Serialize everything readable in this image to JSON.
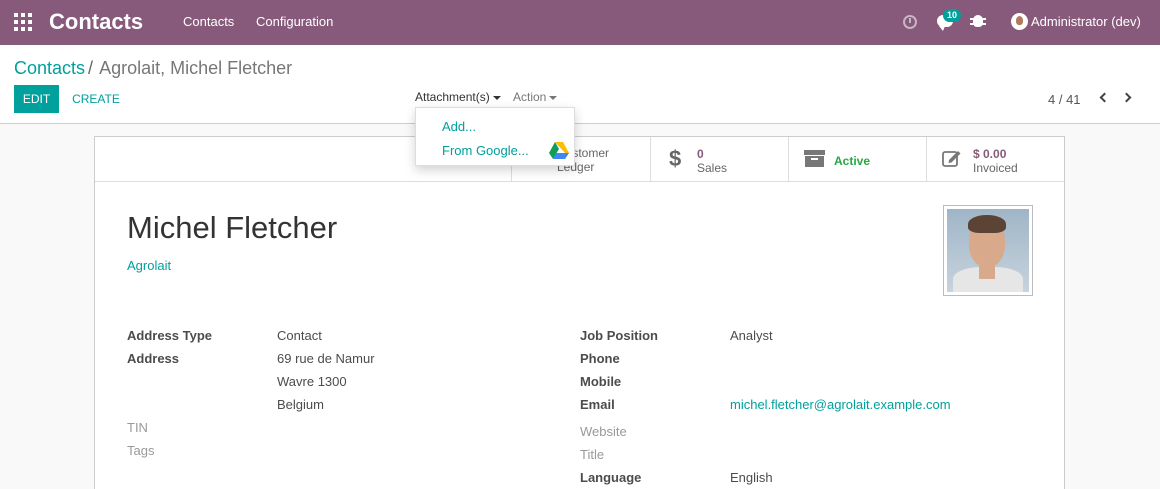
{
  "topbar": {
    "brand": "Contacts",
    "menu": [
      "Contacts",
      "Configuration"
    ],
    "notification_count": "10",
    "user": "Administrator (dev)"
  },
  "control_panel": {
    "breadcrumb_parent": "Contacts",
    "breadcrumb_separator": "/",
    "breadcrumb_current": "Agrolait, Michel Fletcher",
    "edit_label": "EDIT",
    "create_label": "CREATE",
    "attachments_label": "Attachment(s)",
    "action_label": "Action",
    "pager": "4 / 41"
  },
  "attachments_menu": {
    "items": [
      "Add...",
      "From Google..."
    ]
  },
  "stat_buttons": {
    "ledger": {
      "line1": "Customer",
      "line2": "Ledger"
    },
    "sales": {
      "value": "0",
      "label": "Sales"
    },
    "active": {
      "label": "Active"
    },
    "invoiced": {
      "value": "$ 0.00",
      "label": "Invoiced"
    }
  },
  "record": {
    "name": "Michel Fletcher",
    "company": "Agrolait"
  },
  "fields_left": {
    "address_type_label": "Address Type",
    "address_type_value": "Contact",
    "address_label": "Address",
    "street": "69 rue de Namur",
    "city_zip": "Wavre  1300",
    "country": "Belgium",
    "tin_label": "TIN",
    "tags_label": "Tags"
  },
  "fields_right": {
    "job_label": "Job Position",
    "job_value": "Analyst",
    "phone_label": "Phone",
    "mobile_label": "Mobile",
    "email_label": "Email",
    "email_value": "michel.fletcher@agrolait.example.com",
    "website_label": "Website",
    "title_label": "Title",
    "language_label": "Language",
    "language_value": "English"
  },
  "colors": {
    "navbar": "#875a7b",
    "primary": "#00a09d",
    "active": "#28a745"
  }
}
